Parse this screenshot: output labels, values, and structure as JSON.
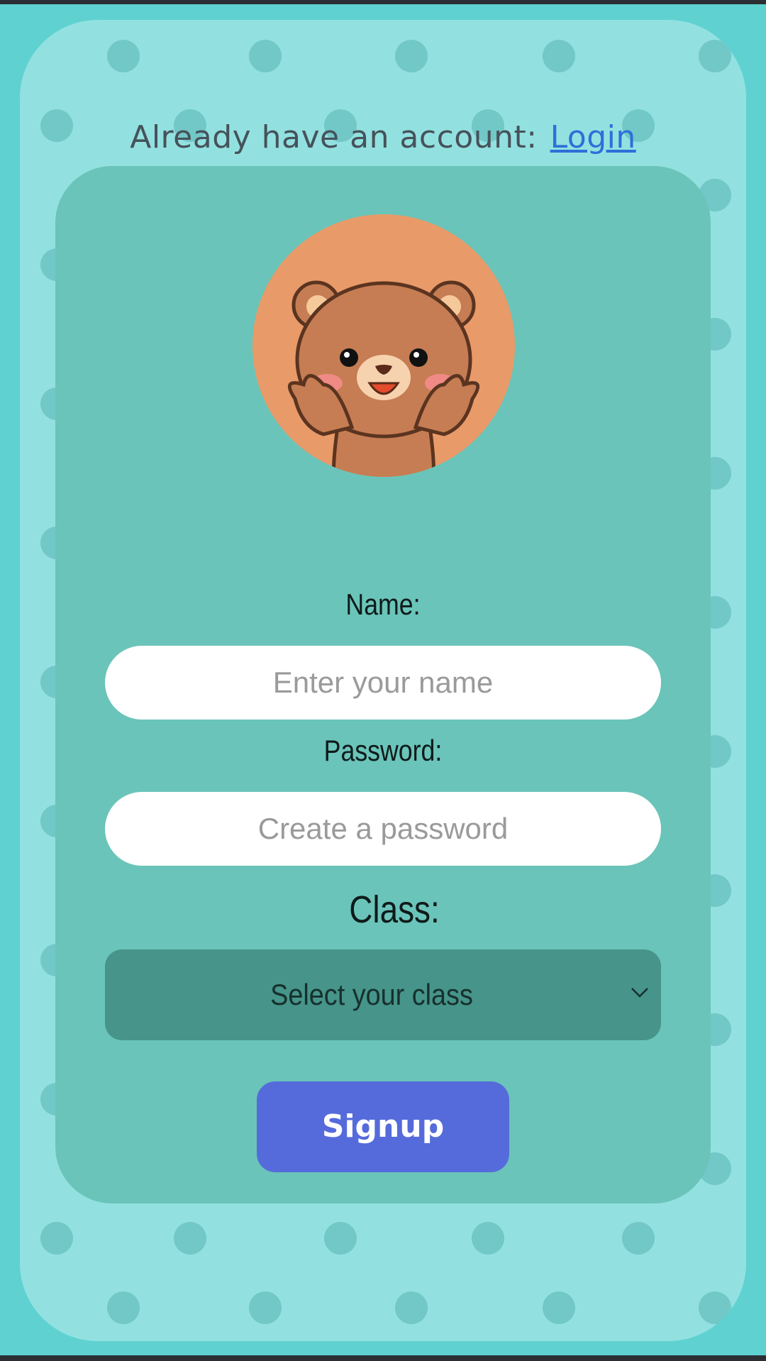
{
  "header": {
    "prompt_text": "Already have an account:",
    "login_link": "Login"
  },
  "form": {
    "name_label": "Name:",
    "name_placeholder": "Enter your name",
    "password_label": "Password:",
    "password_placeholder": "Create a password",
    "class_label": "Class:",
    "class_select_value": "Select your class",
    "signup_label": "Signup"
  },
  "avatar": {
    "icon": "bear-avatar-icon"
  },
  "colors": {
    "background": "#5fd1d1",
    "card_outer": "#92e1e0",
    "card_inner": "#6ac4b9",
    "select_bg": "#46948a",
    "button": "#556bdb",
    "link": "#2d6fd9",
    "avatar_bg": "#e99a69"
  }
}
